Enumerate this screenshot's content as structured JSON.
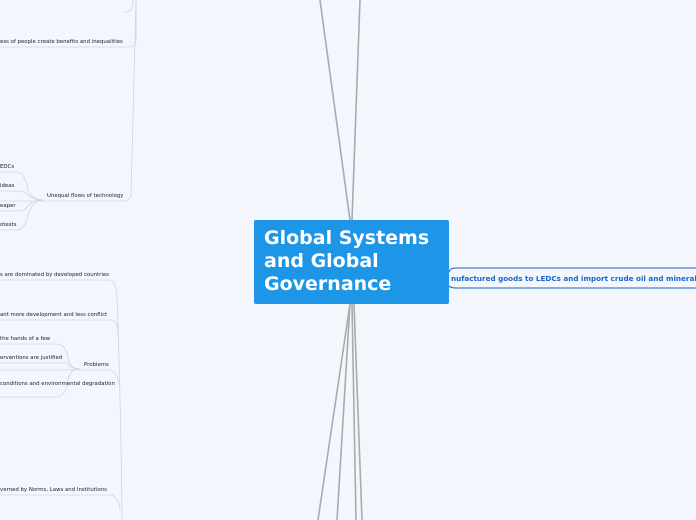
{
  "central_topic": {
    "title": "Global Systems and Global Governance"
  },
  "right_branch": {
    "label": "nufactured goods to LEDCs and import crude oil and minerals"
  },
  "left_nodes": {
    "benefits": "ess of people create benefits and inequalities",
    "ledcs": "EDCs",
    "ideas": "ideas",
    "cheaper": "eaper",
    "protests": "otests",
    "unequal_tech": "Unequal flows of technology",
    "dominated": "s are dominated by developed countries",
    "development": "ant more development and less conflict",
    "hands": "the hands of a few",
    "interventions": "erventions are justified",
    "problems": "Problems",
    "conditions": "conditions and environmental degradation",
    "norms": "verned by Norms, Laws and Institutions"
  },
  "colors": {
    "central_fill": "#1e96e8",
    "connector": "#a9a9a9",
    "right_branch_line": "#1a66c9",
    "background": "#f3f6fd"
  }
}
